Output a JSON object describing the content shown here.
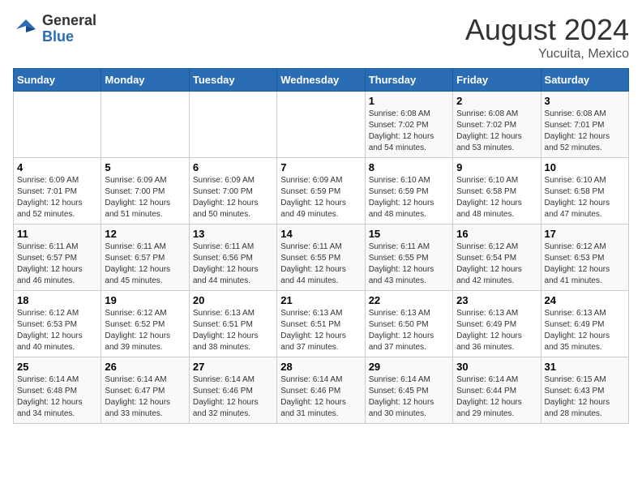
{
  "logo": {
    "general": "General",
    "blue": "Blue"
  },
  "title": "August 2024",
  "location": "Yucuita, Mexico",
  "days_header": [
    "Sunday",
    "Monday",
    "Tuesday",
    "Wednesday",
    "Thursday",
    "Friday",
    "Saturday"
  ],
  "weeks": [
    [
      {
        "num": "",
        "sunrise": "",
        "sunset": "",
        "daylight": ""
      },
      {
        "num": "",
        "sunrise": "",
        "sunset": "",
        "daylight": ""
      },
      {
        "num": "",
        "sunrise": "",
        "sunset": "",
        "daylight": ""
      },
      {
        "num": "",
        "sunrise": "",
        "sunset": "",
        "daylight": ""
      },
      {
        "num": "1",
        "sunrise": "Sunrise: 6:08 AM",
        "sunset": "Sunset: 7:02 PM",
        "daylight": "Daylight: 12 hours and 54 minutes."
      },
      {
        "num": "2",
        "sunrise": "Sunrise: 6:08 AM",
        "sunset": "Sunset: 7:02 PM",
        "daylight": "Daylight: 12 hours and 53 minutes."
      },
      {
        "num": "3",
        "sunrise": "Sunrise: 6:08 AM",
        "sunset": "Sunset: 7:01 PM",
        "daylight": "Daylight: 12 hours and 52 minutes."
      }
    ],
    [
      {
        "num": "4",
        "sunrise": "Sunrise: 6:09 AM",
        "sunset": "Sunset: 7:01 PM",
        "daylight": "Daylight: 12 hours and 52 minutes."
      },
      {
        "num": "5",
        "sunrise": "Sunrise: 6:09 AM",
        "sunset": "Sunset: 7:00 PM",
        "daylight": "Daylight: 12 hours and 51 minutes."
      },
      {
        "num": "6",
        "sunrise": "Sunrise: 6:09 AM",
        "sunset": "Sunset: 7:00 PM",
        "daylight": "Daylight: 12 hours and 50 minutes."
      },
      {
        "num": "7",
        "sunrise": "Sunrise: 6:09 AM",
        "sunset": "Sunset: 6:59 PM",
        "daylight": "Daylight: 12 hours and 49 minutes."
      },
      {
        "num": "8",
        "sunrise": "Sunrise: 6:10 AM",
        "sunset": "Sunset: 6:59 PM",
        "daylight": "Daylight: 12 hours and 48 minutes."
      },
      {
        "num": "9",
        "sunrise": "Sunrise: 6:10 AM",
        "sunset": "Sunset: 6:58 PM",
        "daylight": "Daylight: 12 hours and 48 minutes."
      },
      {
        "num": "10",
        "sunrise": "Sunrise: 6:10 AM",
        "sunset": "Sunset: 6:58 PM",
        "daylight": "Daylight: 12 hours and 47 minutes."
      }
    ],
    [
      {
        "num": "11",
        "sunrise": "Sunrise: 6:11 AM",
        "sunset": "Sunset: 6:57 PM",
        "daylight": "Daylight: 12 hours and 46 minutes."
      },
      {
        "num": "12",
        "sunrise": "Sunrise: 6:11 AM",
        "sunset": "Sunset: 6:57 PM",
        "daylight": "Daylight: 12 hours and 45 minutes."
      },
      {
        "num": "13",
        "sunrise": "Sunrise: 6:11 AM",
        "sunset": "Sunset: 6:56 PM",
        "daylight": "Daylight: 12 hours and 44 minutes."
      },
      {
        "num": "14",
        "sunrise": "Sunrise: 6:11 AM",
        "sunset": "Sunset: 6:55 PM",
        "daylight": "Daylight: 12 hours and 44 minutes."
      },
      {
        "num": "15",
        "sunrise": "Sunrise: 6:11 AM",
        "sunset": "Sunset: 6:55 PM",
        "daylight": "Daylight: 12 hours and 43 minutes."
      },
      {
        "num": "16",
        "sunrise": "Sunrise: 6:12 AM",
        "sunset": "Sunset: 6:54 PM",
        "daylight": "Daylight: 12 hours and 42 minutes."
      },
      {
        "num": "17",
        "sunrise": "Sunrise: 6:12 AM",
        "sunset": "Sunset: 6:53 PM",
        "daylight": "Daylight: 12 hours and 41 minutes."
      }
    ],
    [
      {
        "num": "18",
        "sunrise": "Sunrise: 6:12 AM",
        "sunset": "Sunset: 6:53 PM",
        "daylight": "Daylight: 12 hours and 40 minutes."
      },
      {
        "num": "19",
        "sunrise": "Sunrise: 6:12 AM",
        "sunset": "Sunset: 6:52 PM",
        "daylight": "Daylight: 12 hours and 39 minutes."
      },
      {
        "num": "20",
        "sunrise": "Sunrise: 6:13 AM",
        "sunset": "Sunset: 6:51 PM",
        "daylight": "Daylight: 12 hours and 38 minutes."
      },
      {
        "num": "21",
        "sunrise": "Sunrise: 6:13 AM",
        "sunset": "Sunset: 6:51 PM",
        "daylight": "Daylight: 12 hours and 37 minutes."
      },
      {
        "num": "22",
        "sunrise": "Sunrise: 6:13 AM",
        "sunset": "Sunset: 6:50 PM",
        "daylight": "Daylight: 12 hours and 37 minutes."
      },
      {
        "num": "23",
        "sunrise": "Sunrise: 6:13 AM",
        "sunset": "Sunset: 6:49 PM",
        "daylight": "Daylight: 12 hours and 36 minutes."
      },
      {
        "num": "24",
        "sunrise": "Sunrise: 6:13 AM",
        "sunset": "Sunset: 6:49 PM",
        "daylight": "Daylight: 12 hours and 35 minutes."
      }
    ],
    [
      {
        "num": "25",
        "sunrise": "Sunrise: 6:14 AM",
        "sunset": "Sunset: 6:48 PM",
        "daylight": "Daylight: 12 hours and 34 minutes."
      },
      {
        "num": "26",
        "sunrise": "Sunrise: 6:14 AM",
        "sunset": "Sunset: 6:47 PM",
        "daylight": "Daylight: 12 hours and 33 minutes."
      },
      {
        "num": "27",
        "sunrise": "Sunrise: 6:14 AM",
        "sunset": "Sunset: 6:46 PM",
        "daylight": "Daylight: 12 hours and 32 minutes."
      },
      {
        "num": "28",
        "sunrise": "Sunrise: 6:14 AM",
        "sunset": "Sunset: 6:46 PM",
        "daylight": "Daylight: 12 hours and 31 minutes."
      },
      {
        "num": "29",
        "sunrise": "Sunrise: 6:14 AM",
        "sunset": "Sunset: 6:45 PM",
        "daylight": "Daylight: 12 hours and 30 minutes."
      },
      {
        "num": "30",
        "sunrise": "Sunrise: 6:14 AM",
        "sunset": "Sunset: 6:44 PM",
        "daylight": "Daylight: 12 hours and 29 minutes."
      },
      {
        "num": "31",
        "sunrise": "Sunrise: 6:15 AM",
        "sunset": "Sunset: 6:43 PM",
        "daylight": "Daylight: 12 hours and 28 minutes."
      }
    ]
  ]
}
